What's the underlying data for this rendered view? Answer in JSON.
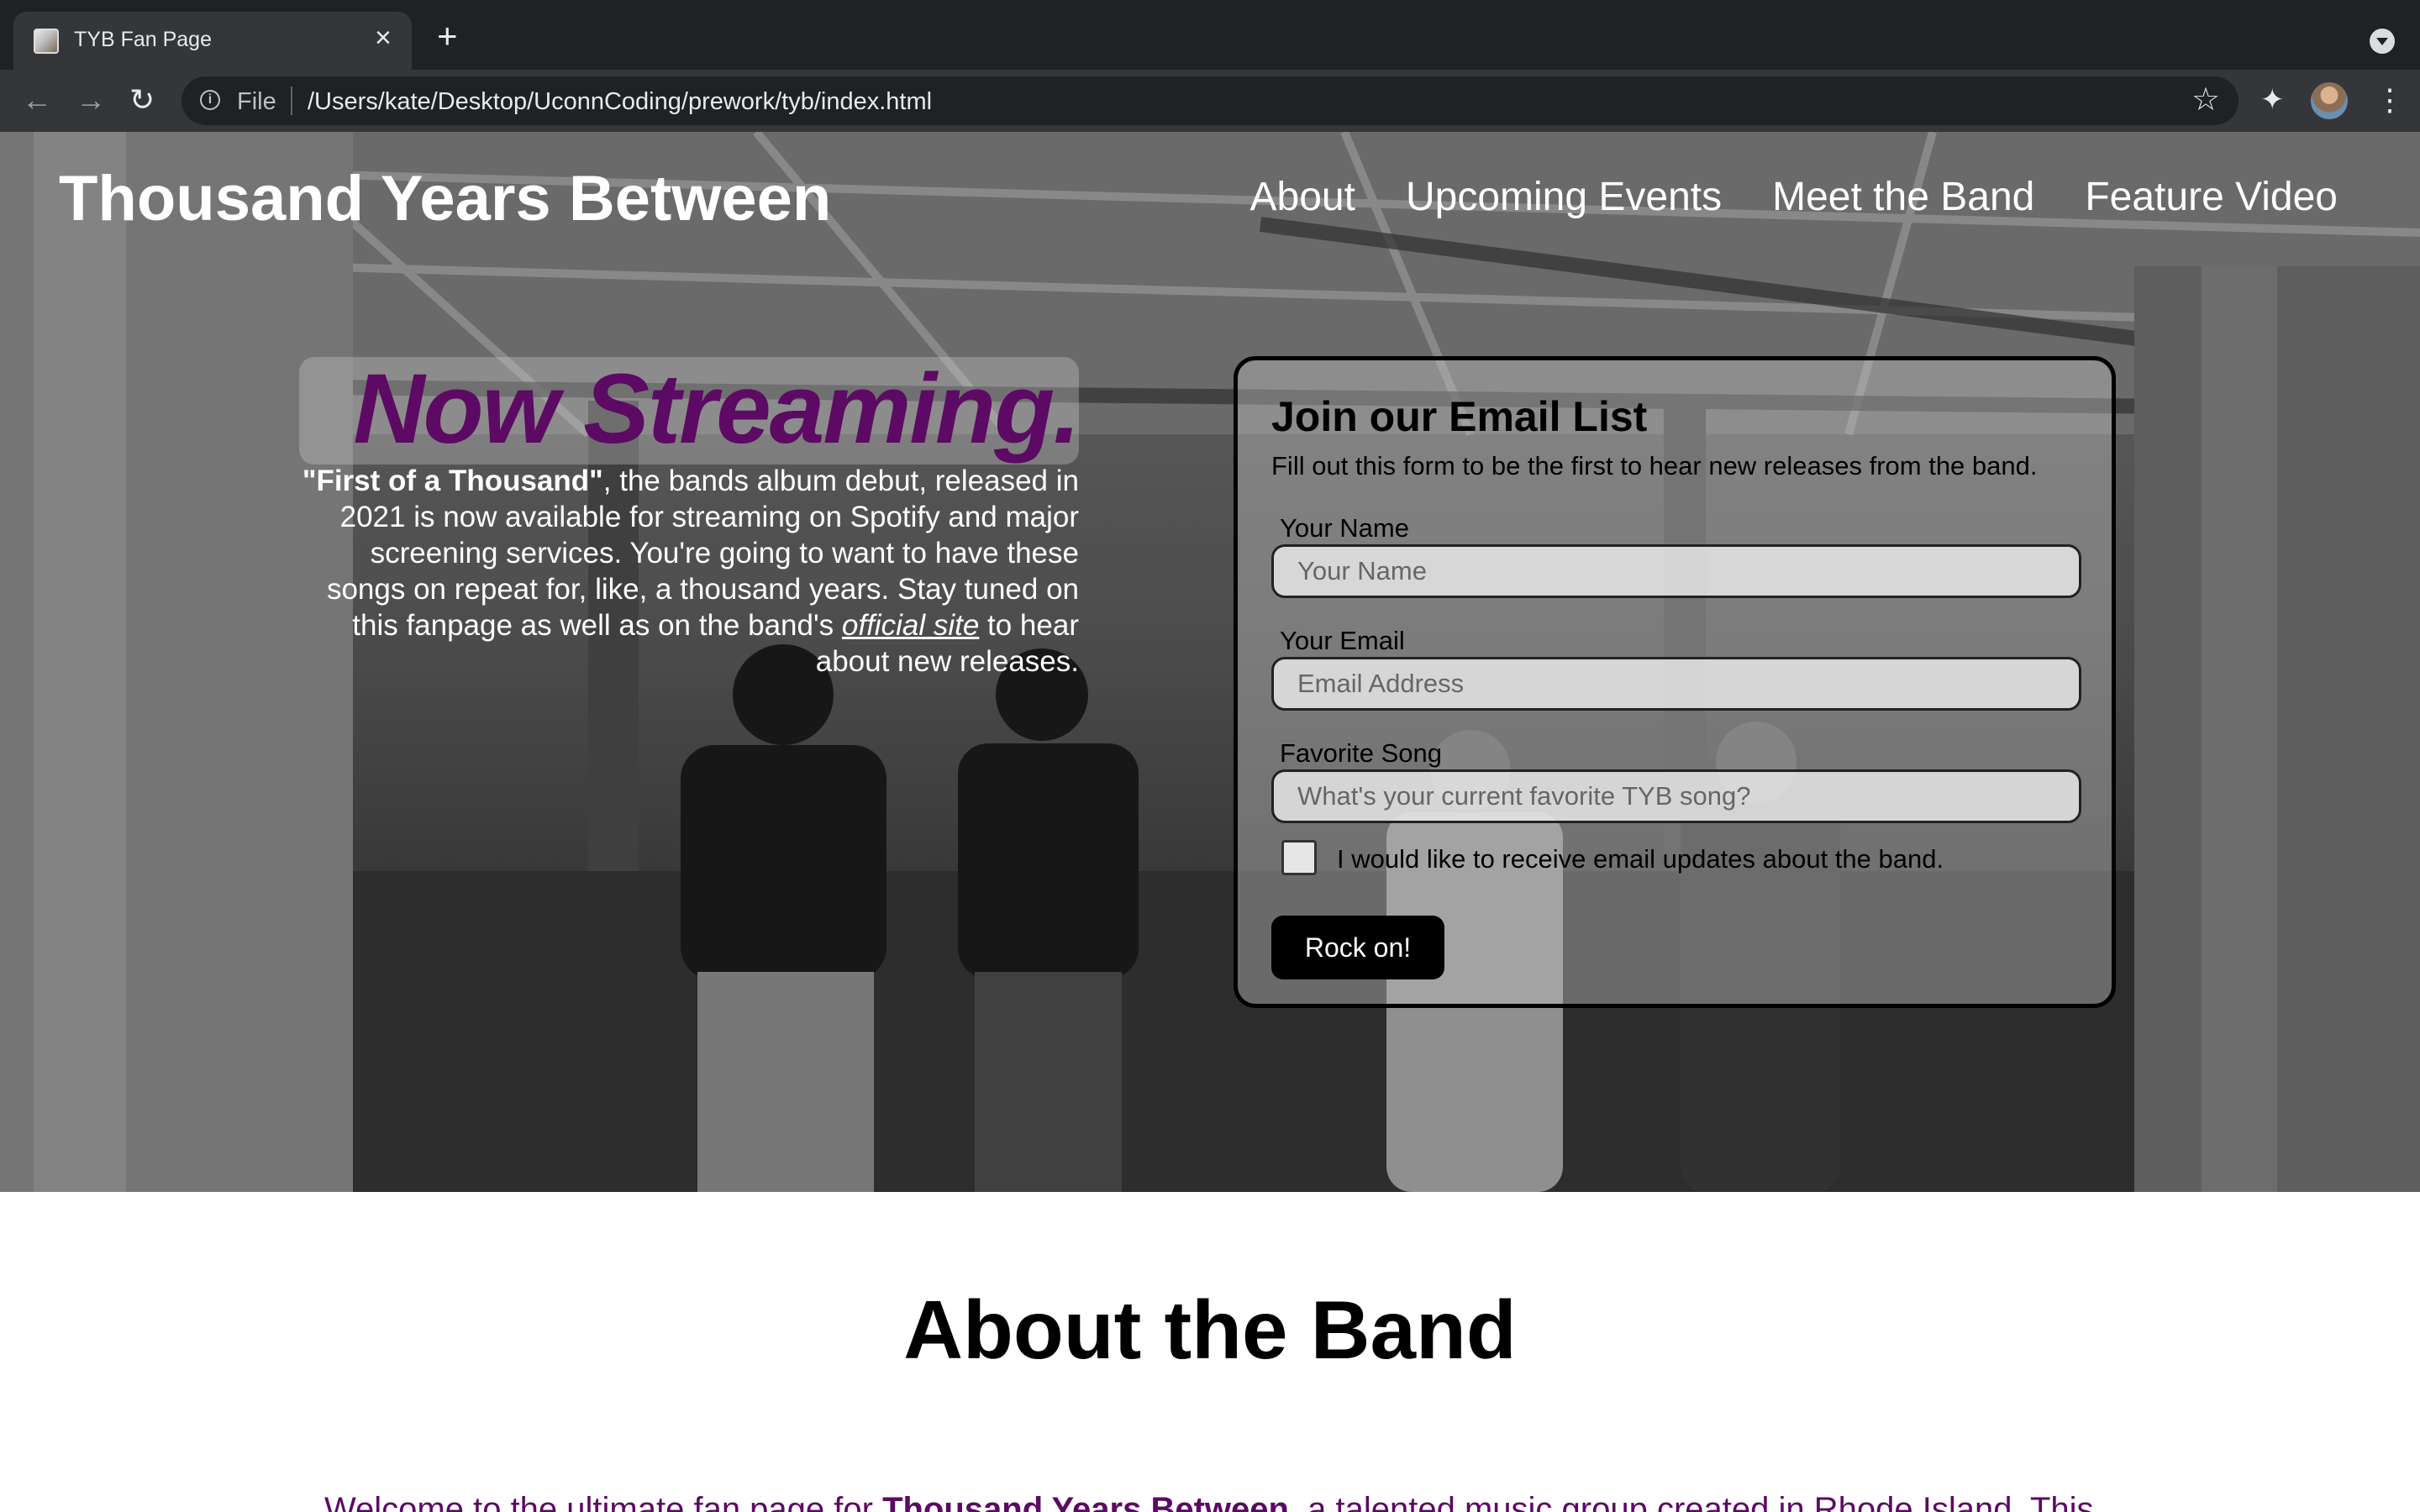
{
  "browser": {
    "tab_title": "TYB Fan Page",
    "url_scheme": "File",
    "url": "/Users/kate/Desktop/UconnCoding/prework/tyb/index.html"
  },
  "header": {
    "title": "Thousand Years Between",
    "nav": [
      {
        "label": "About"
      },
      {
        "label": "Upcoming Events"
      },
      {
        "label": "Meet the Band"
      },
      {
        "label": "Feature Video"
      }
    ]
  },
  "hero": {
    "heading": "Now Streaming.",
    "album": "\"First of a Thousand\"",
    "text_a": ", the bands album debut, released in 2021 is now available for streaming on Spotify and major screening services. You're going to want to have these songs on repeat for, like, a thousand years. Stay tuned on this fanpage as well as on the band's ",
    "link": "official site",
    "text_b": " to hear about new releases."
  },
  "form": {
    "title": "Join our Email List",
    "subtitle": "Fill out this form to be the first to hear new releases from the band.",
    "name_label": "Your Name",
    "name_placeholder": "Your Name",
    "email_label": "Your Email",
    "email_placeholder": "Email Address",
    "song_label": "Favorite Song",
    "song_placeholder": "What's your current favorite TYB song?",
    "checkbox_label": "I would like to receive email updates about the band.",
    "submit": "Rock on!"
  },
  "about": {
    "title": "About the Band",
    "text_a": "Welcome to the ultimate fan page for ",
    "band": "Thousand Years Between",
    "text_b": ", a talented music group created in Rhode Island. This"
  }
}
